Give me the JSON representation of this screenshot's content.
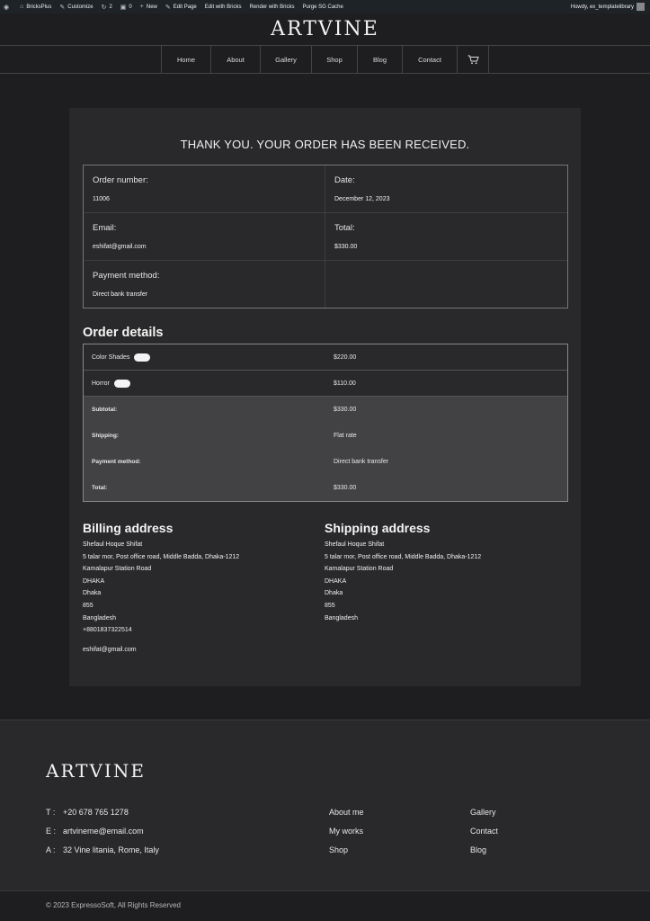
{
  "adminbar": {
    "site": "BricksPlus",
    "customize": "Customize",
    "updates": "2",
    "comments": "0",
    "new": "New",
    "edit_page": "Edit Page",
    "edit_bricks": "Edit with Bricks",
    "render_bricks": "Render with Bricks",
    "purge": "Purge SG Cache",
    "howdy": "Howdy, ex_templatelibrary"
  },
  "header": {
    "logo": "ARTVINE"
  },
  "nav": {
    "items": [
      "Home",
      "About",
      "Gallery",
      "Shop",
      "Blog",
      "Contact"
    ],
    "cart_icon": "cart-icon"
  },
  "order": {
    "thanks": "THANK YOU. YOUR ORDER HAS BEEN RECEIVED.",
    "number_label": "Order number:",
    "number": "11006",
    "date_label": "Date:",
    "date": "December 12, 2023",
    "email_label": "Email:",
    "email": "eshifat@gmail.com",
    "total_label": "Total:",
    "total": "$330.00",
    "payment_label": "Payment method:",
    "payment": "Direct bank transfer"
  },
  "details": {
    "title": "Order details",
    "items": [
      {
        "name": "Color Shades",
        "price": "$220.00"
      },
      {
        "name": "Horror",
        "price": "$110.00"
      }
    ],
    "totals": [
      {
        "label": "Subtotal:",
        "value": "$330.00"
      },
      {
        "label": "Shipping:",
        "value": "Flat rate"
      },
      {
        "label": "Payment method:",
        "value": "Direct bank transfer"
      },
      {
        "label": "Total:",
        "value": "$330.00"
      }
    ]
  },
  "billing": {
    "title": "Billing address",
    "lines": [
      "Shefaul Hoque Shifat",
      "5 talar mor, Post office road, Middle Badda, Dhaka-1212",
      "Kamalapur Station Road",
      "DHAKA",
      "Dhaka",
      "855",
      "Bangladesh",
      "+8801837322514"
    ],
    "email": "eshifat@gmail.com"
  },
  "shipping": {
    "title": "Shipping address",
    "lines": [
      "Shefaul Hoque Shifat",
      "5 talar mor, Post office road, Middle Badda, Dhaka-1212",
      "Kamalapur Station Road",
      "DHAKA",
      "Dhaka",
      "855",
      "Bangladesh"
    ]
  },
  "footer": {
    "logo": "ARTVINE",
    "phone_key": "T :",
    "phone": "+20 678 765 1278",
    "email_key": "E :",
    "email": "artvineme@email.com",
    "address_key": "A :",
    "address": "32 Vine litania, Rome, Italy",
    "col1": [
      "About me",
      "My works",
      "Shop"
    ],
    "col2": [
      "Gallery",
      "Contact",
      "Blog"
    ],
    "copyright": "© 2023 ExpressoSoft, All Rights Reserved"
  },
  "colors": {
    "background": "#1e1e20",
    "panel": "#29292b",
    "totals_bg": "#424244",
    "admin_bar": "#1d2327"
  }
}
